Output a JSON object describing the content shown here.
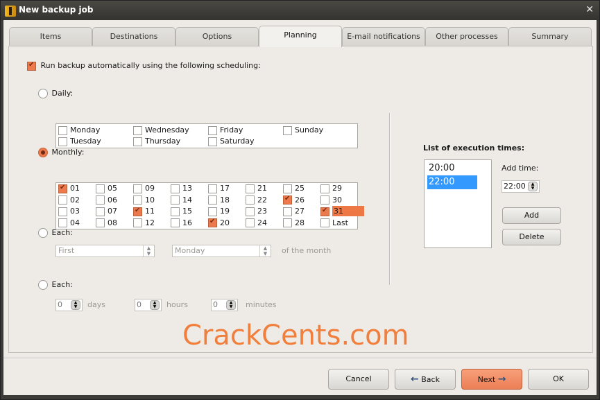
{
  "window": {
    "title": "New backup job",
    "close_icon": "close-icon"
  },
  "tabs": [
    {
      "label": "Items",
      "active": false
    },
    {
      "label": "Destinations",
      "active": false
    },
    {
      "label": "Options",
      "active": false
    },
    {
      "label": "Planning",
      "active": true
    },
    {
      "label": "E-mail notifications",
      "active": false
    },
    {
      "label": "Other processes",
      "active": false
    },
    {
      "label": "Summary",
      "active": false
    }
  ],
  "planning": {
    "auto_run": {
      "label": "Run backup automatically using the following scheduling:",
      "checked": true
    },
    "daily": {
      "label": "Daily:",
      "selected": false,
      "days": [
        {
          "label": "Monday",
          "checked": false
        },
        {
          "label": "Tuesday",
          "checked": false
        },
        {
          "label": "Wednesday",
          "checked": false
        },
        {
          "label": "Thursday",
          "checked": false
        },
        {
          "label": "Friday",
          "checked": false
        },
        {
          "label": "Saturday",
          "checked": false
        },
        {
          "label": "Sunday",
          "checked": false
        }
      ]
    },
    "monthly": {
      "label": "Monthly:",
      "selected": true,
      "days": [
        {
          "label": "01",
          "checked": true
        },
        {
          "label": "02",
          "checked": false
        },
        {
          "label": "03",
          "checked": false
        },
        {
          "label": "04",
          "checked": false
        },
        {
          "label": "05",
          "checked": false
        },
        {
          "label": "06",
          "checked": false
        },
        {
          "label": "07",
          "checked": false
        },
        {
          "label": "08",
          "checked": false
        },
        {
          "label": "09",
          "checked": false
        },
        {
          "label": "10",
          "checked": false
        },
        {
          "label": "11",
          "checked": true
        },
        {
          "label": "12",
          "checked": false
        },
        {
          "label": "13",
          "checked": false
        },
        {
          "label": "14",
          "checked": false
        },
        {
          "label": "15",
          "checked": false
        },
        {
          "label": "16",
          "checked": false
        },
        {
          "label": "17",
          "checked": false
        },
        {
          "label": "18",
          "checked": false
        },
        {
          "label": "19",
          "checked": false
        },
        {
          "label": "20",
          "checked": true
        },
        {
          "label": "21",
          "checked": false
        },
        {
          "label": "22",
          "checked": false
        },
        {
          "label": "23",
          "checked": false
        },
        {
          "label": "24",
          "checked": false
        },
        {
          "label": "25",
          "checked": false
        },
        {
          "label": "26",
          "checked": true
        },
        {
          "label": "27",
          "checked": false
        },
        {
          "label": "28",
          "checked": false
        },
        {
          "label": "29",
          "checked": false
        },
        {
          "label": "30",
          "checked": false
        },
        {
          "label": "31",
          "checked": true,
          "highlighted": true
        },
        {
          "label": "Last",
          "checked": false
        }
      ]
    },
    "each_weekday": {
      "label": "Each:",
      "selected": false,
      "ordinal": "First",
      "weekday": "Monday",
      "suffix": "of the month"
    },
    "each_interval": {
      "label": "Each:",
      "selected": false,
      "days_value": "0",
      "days_label": "days",
      "hours_value": "0",
      "hours_label": "hours",
      "minutes_value": "0",
      "minutes_label": "minutes"
    },
    "execution_times": {
      "title": "List of execution times:",
      "items": [
        {
          "label": "20:00",
          "selected": false
        },
        {
          "label": "22:00",
          "selected": true
        }
      ],
      "add_time_label": "Add time:",
      "add_time_value": "22:00",
      "add_button": "Add",
      "delete_button": "Delete"
    }
  },
  "watermark": "CrackCents.com",
  "footer": {
    "cancel": "Cancel",
    "back": "Back",
    "next": "Next",
    "ok": "OK",
    "back_icon": "←",
    "next_icon": "→"
  },
  "colors": {
    "accent": "#ec7a4c",
    "selection": "#3399ff",
    "watermark": "#f07f3e"
  }
}
